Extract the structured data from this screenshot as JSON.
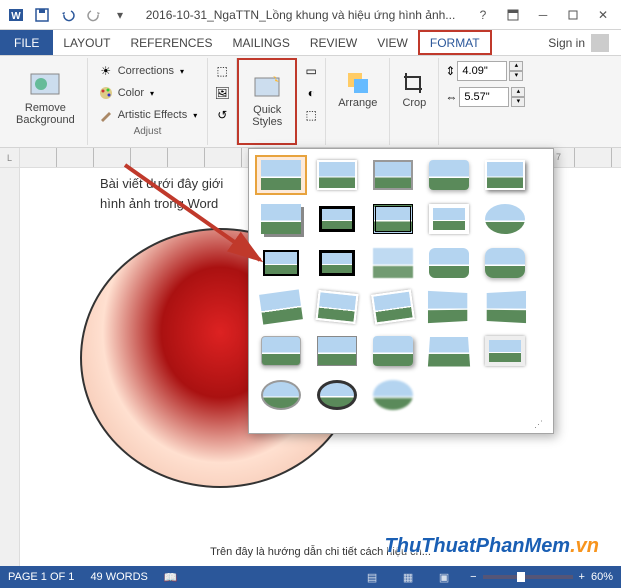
{
  "title": "2016-10-31_NgaTTN_Lồng khung và hiệu ứng hình ảnh...",
  "tabs": {
    "file": "FILE",
    "layout": "LAYOUT",
    "references": "REFERENCES",
    "mailings": "MAILINGS",
    "review": "REVIEW",
    "view": "VIEW",
    "format": "FORMAT",
    "signin": "Sign in"
  },
  "ribbon": {
    "remove_bg": "Remove\nBackground",
    "corrections": "Corrections",
    "color": "Color",
    "artistic": "Artistic Effects",
    "adjust": "Adjust",
    "quick_styles": "Quick\nStyles",
    "arrange": "Arrange",
    "crop": "Crop",
    "height": "4.09\"",
    "width": "5.57\""
  },
  "document": {
    "top_text": "Bài viết dưới đây giới",
    "top_text2": "hình ảnh trong Word",
    "bottom_text": "Trên đây là hướng dẫn chi tiết cách hiệu ch..."
  },
  "status": {
    "page": "PAGE 1 OF 1",
    "words": "49 WORDS",
    "zoom": "60%"
  },
  "watermark": {
    "a": "ThuThuatPhanMem",
    "b": ".vn"
  },
  "ruler_left": "L",
  "ruler_mark": "7"
}
